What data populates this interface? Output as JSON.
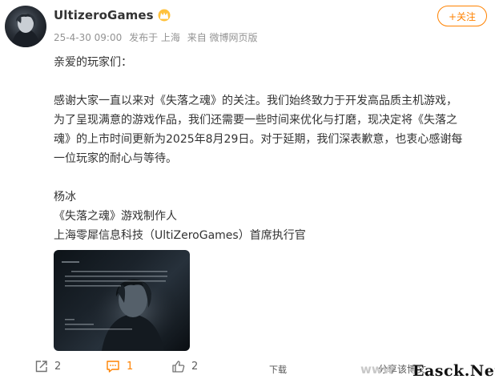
{
  "post": {
    "username": "UltizeroGames",
    "badge_icon": "crown-icon",
    "meta": {
      "date": "25-4-30 09:00",
      "location": "发布于 上海",
      "source": "来自 微博网页版"
    },
    "follow_label": "+关注",
    "body": {
      "greeting": "亲爱的玩家们：",
      "paragraph_lines": [
        "感谢大家一直以来对《失落之魂》的关注。我们始终致力于开发高品质主机游戏，",
        "为了呈现满意的游戏作品，我们还需要一些时间来优化与打磨，现决定将《失落之",
        "魂》的上市时间更新为2025年8月29日。对于延期，我们深表歉意，也衷心感谢每",
        "一位玩家的耐心与等待。"
      ],
      "signature": [
        "杨冰",
        "《失落之魂》游戏制作人",
        "上海零犀信息科技（UltiZeroGames）首席执行官"
      ]
    }
  },
  "toolbar": {
    "repost_count": "2",
    "comment_count": "1",
    "like_count": "2",
    "download_label": "下载",
    "share_label": "分享该博文"
  },
  "watermark": {
    "text": "Easck.Net",
    "faint_text": "www"
  },
  "colors": {
    "accent": "#ff8200",
    "meta_text": "#939393"
  }
}
